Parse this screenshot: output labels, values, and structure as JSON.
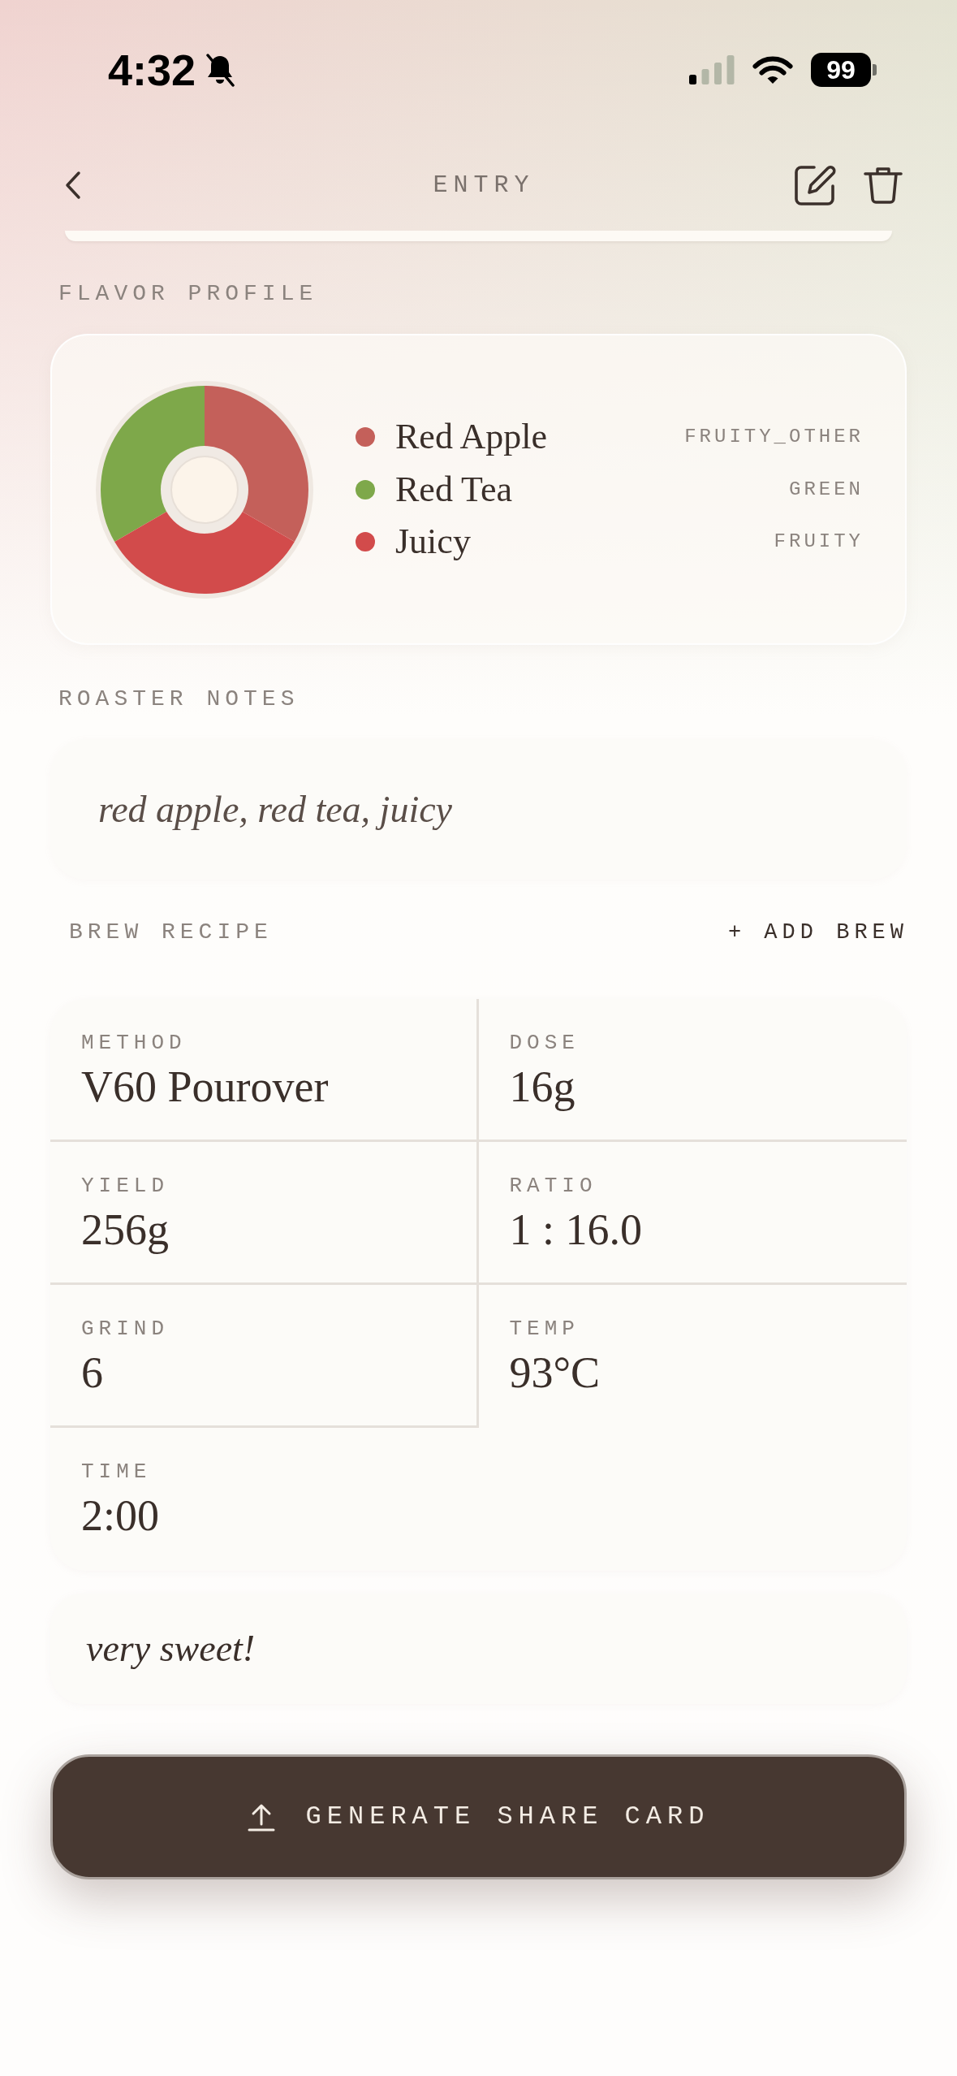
{
  "status_bar": {
    "time": "4:32",
    "silent": true,
    "battery": "99"
  },
  "header": {
    "title": "ENTRY"
  },
  "flavor_profile": {
    "heading": "FLAVOR PROFILE",
    "notes": [
      {
        "name": "Red Apple",
        "category": "FRUITY_OTHER",
        "color": "#c4605a"
      },
      {
        "name": "Red Tea",
        "category": "GREEN",
        "color": "#7ea84a"
      },
      {
        "name": "Juicy",
        "category": "FRUITY",
        "color": "#d24b4b"
      }
    ]
  },
  "roaster_notes": {
    "heading": "ROASTER NOTES",
    "text": "red apple, red tea, juicy"
  },
  "brew_recipe": {
    "heading": "BREW RECIPE",
    "add_label": "+ ADD BREW",
    "fields": [
      {
        "label": "METHOD",
        "value": "V60 Pourover"
      },
      {
        "label": "DOSE",
        "value": "16g"
      },
      {
        "label": "YIELD",
        "value": "256g"
      },
      {
        "label": "RATIO",
        "value": "1 : 16.0"
      },
      {
        "label": "GRIND",
        "value": "6"
      },
      {
        "label": "TEMP",
        "value": "93°C"
      },
      {
        "label": "TIME",
        "value": "2:00"
      }
    ]
  },
  "tasting_note": {
    "text": "very sweet!"
  },
  "share_button": {
    "label": "GENERATE SHARE CARD"
  }
}
